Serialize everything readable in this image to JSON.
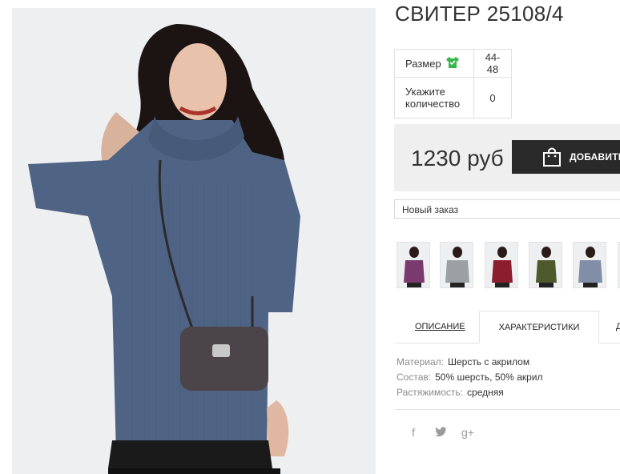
{
  "product": {
    "title": "СВИТЕР 25108/4",
    "size_label": "Размер",
    "size_value": "44-48",
    "qty_label": "Укажите количество",
    "qty_value": "0",
    "price": "1230 руб",
    "add_button": "ДОБАВИТЬ",
    "order_select": "Новый заказ"
  },
  "thumbnails": [
    {
      "name": "thumb-purple",
      "color": "#7a3a6e"
    },
    {
      "name": "thumb-gray",
      "color": "#9aa0a3"
    },
    {
      "name": "thumb-burgundy",
      "color": "#8c1d2e"
    },
    {
      "name": "thumb-olive",
      "color": "#4e5a2c"
    },
    {
      "name": "thumb-blue",
      "color": "#5d6e8e"
    }
  ],
  "tabs": {
    "description": "ОПИСАНИЕ",
    "characteristics": "ХАРАКТЕРИСТИКИ",
    "more": "Д"
  },
  "attributes": [
    {
      "key": "Материал:",
      "value": "Шерсть с акрилом"
    },
    {
      "key": "Состав:",
      "value": "50% шерсть, 50% акрил"
    },
    {
      "key": "Растяжимость:",
      "value": "средняя"
    }
  ],
  "social": {
    "facebook": "f",
    "twitter": "twitter-bird",
    "gplus": "g+"
  },
  "colors": {
    "sweater": "#4f6384",
    "button": "#2a2a2a",
    "price_bg": "#efefef",
    "size_icon": "#35b84a"
  }
}
